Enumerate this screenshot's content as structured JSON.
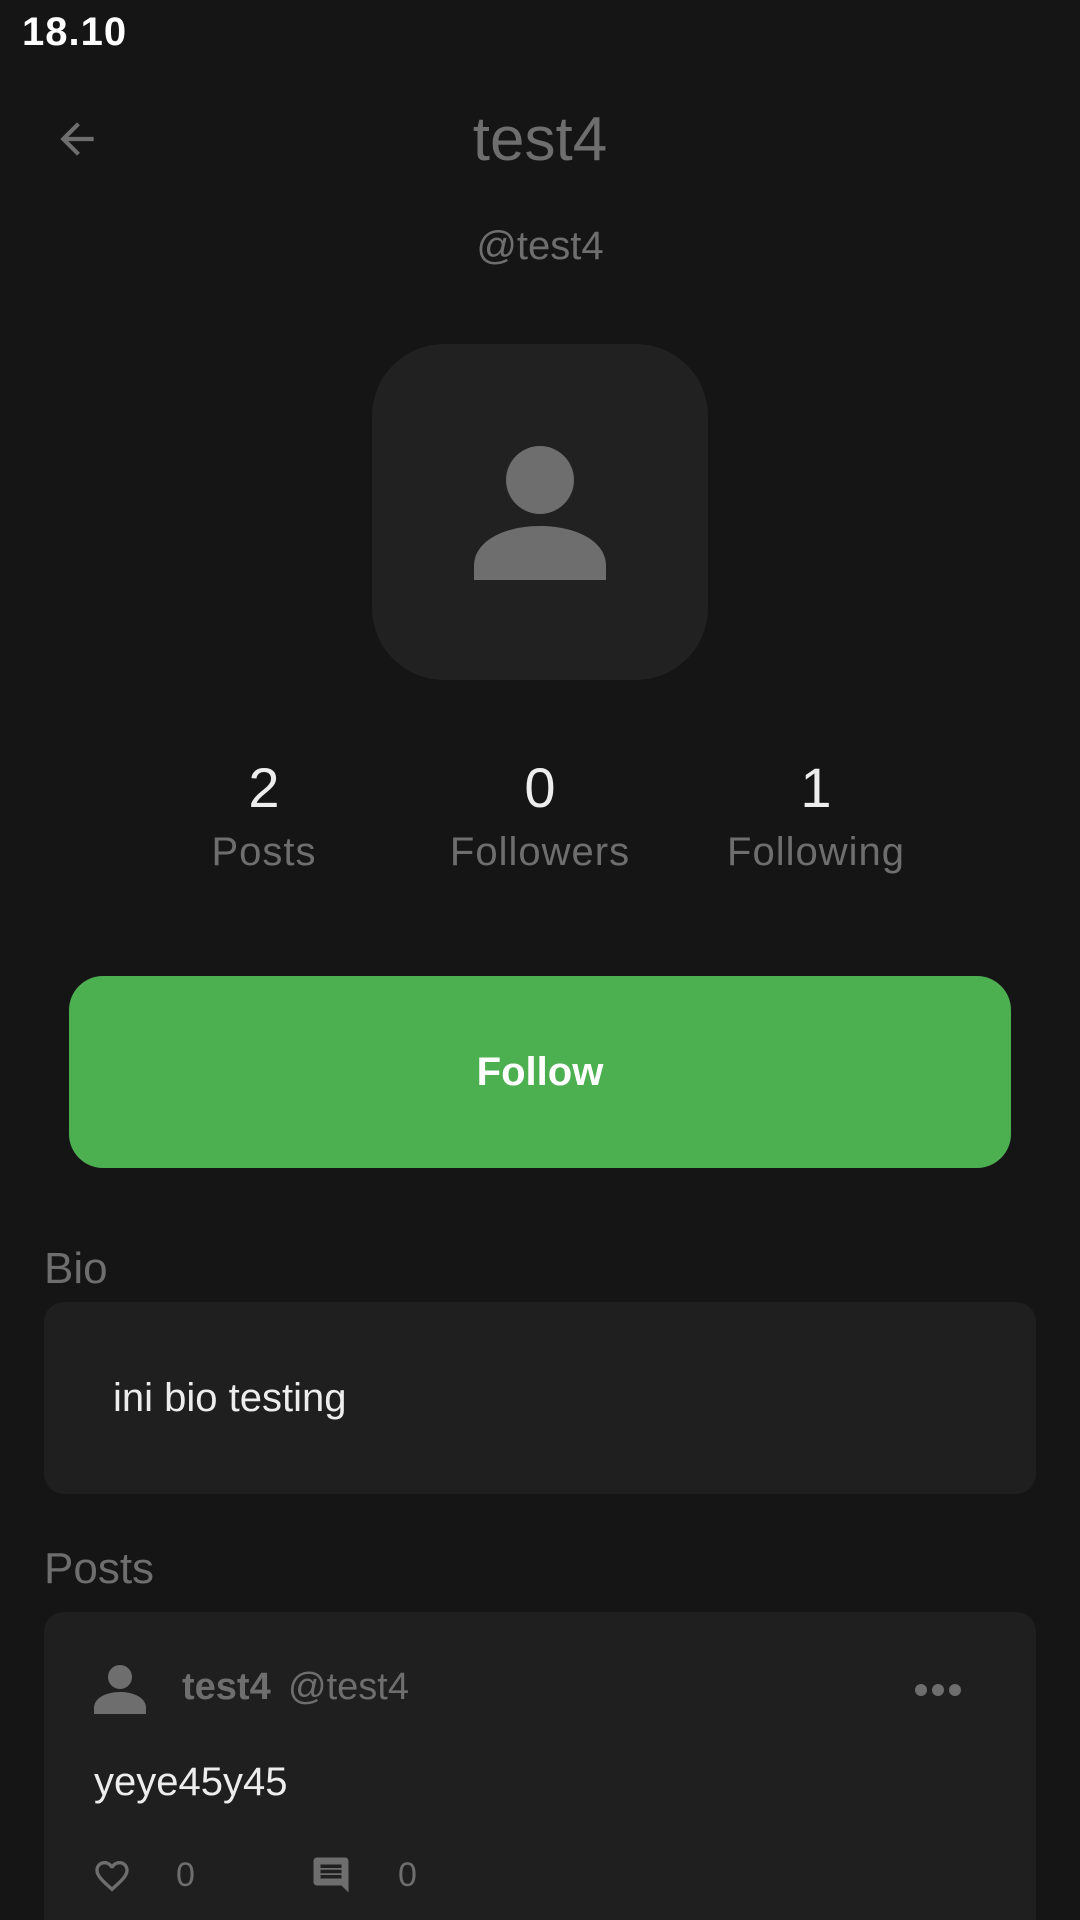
{
  "status_bar": {
    "time": "18.10"
  },
  "header": {
    "title": "test4",
    "back_icon": "arrow-back-icon"
  },
  "profile": {
    "handle": "@test4",
    "avatar_icon": "person-icon",
    "stats": [
      {
        "value": "2",
        "label": "Posts"
      },
      {
        "value": "0",
        "label": "Followers"
      },
      {
        "value": "1",
        "label": "Following"
      }
    ]
  },
  "actions": {
    "follow_label": "Follow"
  },
  "bio": {
    "heading": "Bio",
    "text": "ini bio testing"
  },
  "posts": {
    "heading": "Posts",
    "items": [
      {
        "author": "test4",
        "handle": "@test4",
        "text": "yeye45y45",
        "likes": "0",
        "comments": "0"
      }
    ]
  },
  "colors": {
    "background": "#151515",
    "card": "#1f1f1f",
    "accent": "#4caf50",
    "muted_text": "#6e6e6e"
  }
}
